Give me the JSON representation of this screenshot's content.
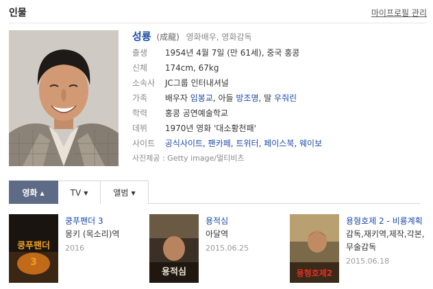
{
  "header": {
    "title": "인물",
    "manage_link": "마이프로필 관리"
  },
  "person": {
    "name": "성룡",
    "hanja": "(成龍)",
    "occupation": "영화배우, 영화감독",
    "rows": [
      {
        "label": "출생",
        "value": "1954년 4월 7일 (만 61세), 중국 홍콩"
      },
      {
        "label": "신체",
        "value": "174cm, 67kg"
      },
      {
        "label": "소속사",
        "value": "JC그룹 인터내셔널"
      },
      {
        "label": "가족",
        "prefix": "배우자 ",
        "link1": "임봉교",
        "mid1": ", 아들 ",
        "link2": "방조명",
        "mid2": ", 딸 ",
        "link3": "우줘린"
      },
      {
        "label": "학력",
        "value": "홍콩 공연예술학교"
      },
      {
        "label": "데뷔",
        "value": "1970년 영화 '대소황천패'"
      },
      {
        "label": "사이트",
        "links": [
          "공식사이트",
          "팬카페",
          "트위터",
          "페이스북",
          "웨이보"
        ]
      }
    ],
    "photo_credit": "사진제공 : Getty image/멀티비츠"
  },
  "tabs": [
    {
      "label": "영화",
      "caret": "▲",
      "active": true
    },
    {
      "label": "TV",
      "caret": "▼",
      "active": false
    },
    {
      "label": "앨범",
      "caret": "▼",
      "active": false
    }
  ],
  "films": [
    {
      "title": "쿵푸팬더 3",
      "role": "몽키 (목소리)역",
      "date": "2016",
      "poster_text": "쿵푸팬더"
    },
    {
      "title": "용적심",
      "role": "아달역",
      "date": "2015.06.25",
      "poster_text": "용적심"
    },
    {
      "title": "용형호제 2 - 비룡계획",
      "role": "감독,재키역,제작,각본,무술감독",
      "date": "2015.06.18",
      "poster_text": "용형호제2"
    }
  ],
  "colors": {
    "link": "#1a49a8",
    "tab_active": "#5e6b87"
  }
}
